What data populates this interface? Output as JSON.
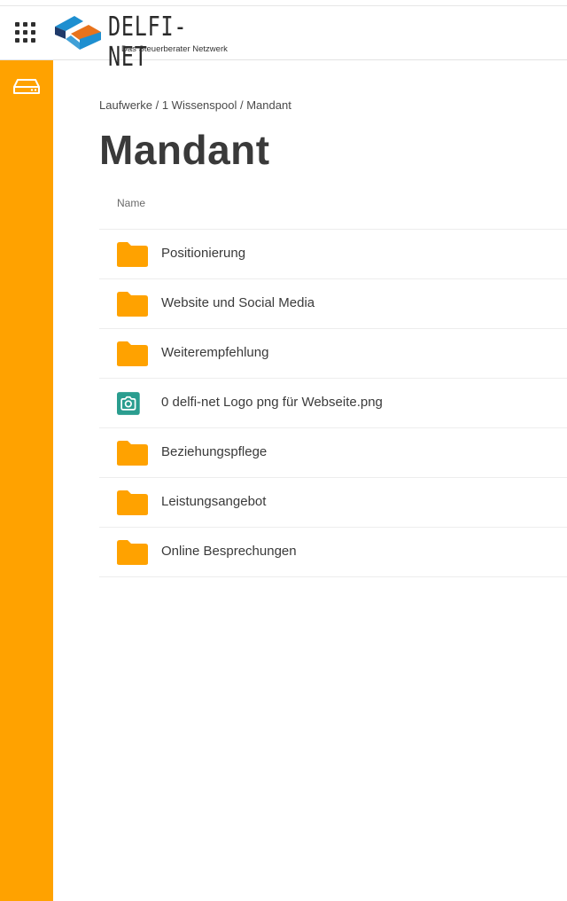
{
  "header": {
    "apps_icon": "apps-grid-icon",
    "logo": {
      "title": "DELFI-NET",
      "subtitle": "Das Steuerberater Netzwerk",
      "colors": {
        "blue": "#1e8fd0",
        "orange": "#e8731c",
        "dark": "#1f3a6a"
      }
    }
  },
  "sidebar": {
    "color": "#ffa200",
    "items": [
      {
        "icon": "drive-icon"
      }
    ]
  },
  "breadcrumb": {
    "items": [
      "Laufwerke",
      "1 Wissenspool",
      "Mandant"
    ],
    "separator": " / "
  },
  "page": {
    "title": "Mandant"
  },
  "table": {
    "column_header": "Name",
    "rows": [
      {
        "type": "folder",
        "icon": "folder-icon",
        "name": "Positionierung"
      },
      {
        "type": "folder",
        "icon": "folder-icon",
        "name": "Website und Social Media"
      },
      {
        "type": "folder",
        "icon": "folder-icon",
        "name": "Weiterempfehlung"
      },
      {
        "type": "image",
        "icon": "camera-icon",
        "name": "0 delfi-net Logo png für Webseite.png"
      },
      {
        "type": "folder",
        "icon": "folder-icon",
        "name": "Beziehungspflege"
      },
      {
        "type": "folder",
        "icon": "folder-icon",
        "name": "Leistungsangebot"
      },
      {
        "type": "folder",
        "icon": "folder-icon",
        "name": "Online Besprechungen"
      }
    ]
  },
  "colors": {
    "folder": "#ffa200",
    "image_icon": "#2a9d8f",
    "accent": "#ffa200"
  }
}
